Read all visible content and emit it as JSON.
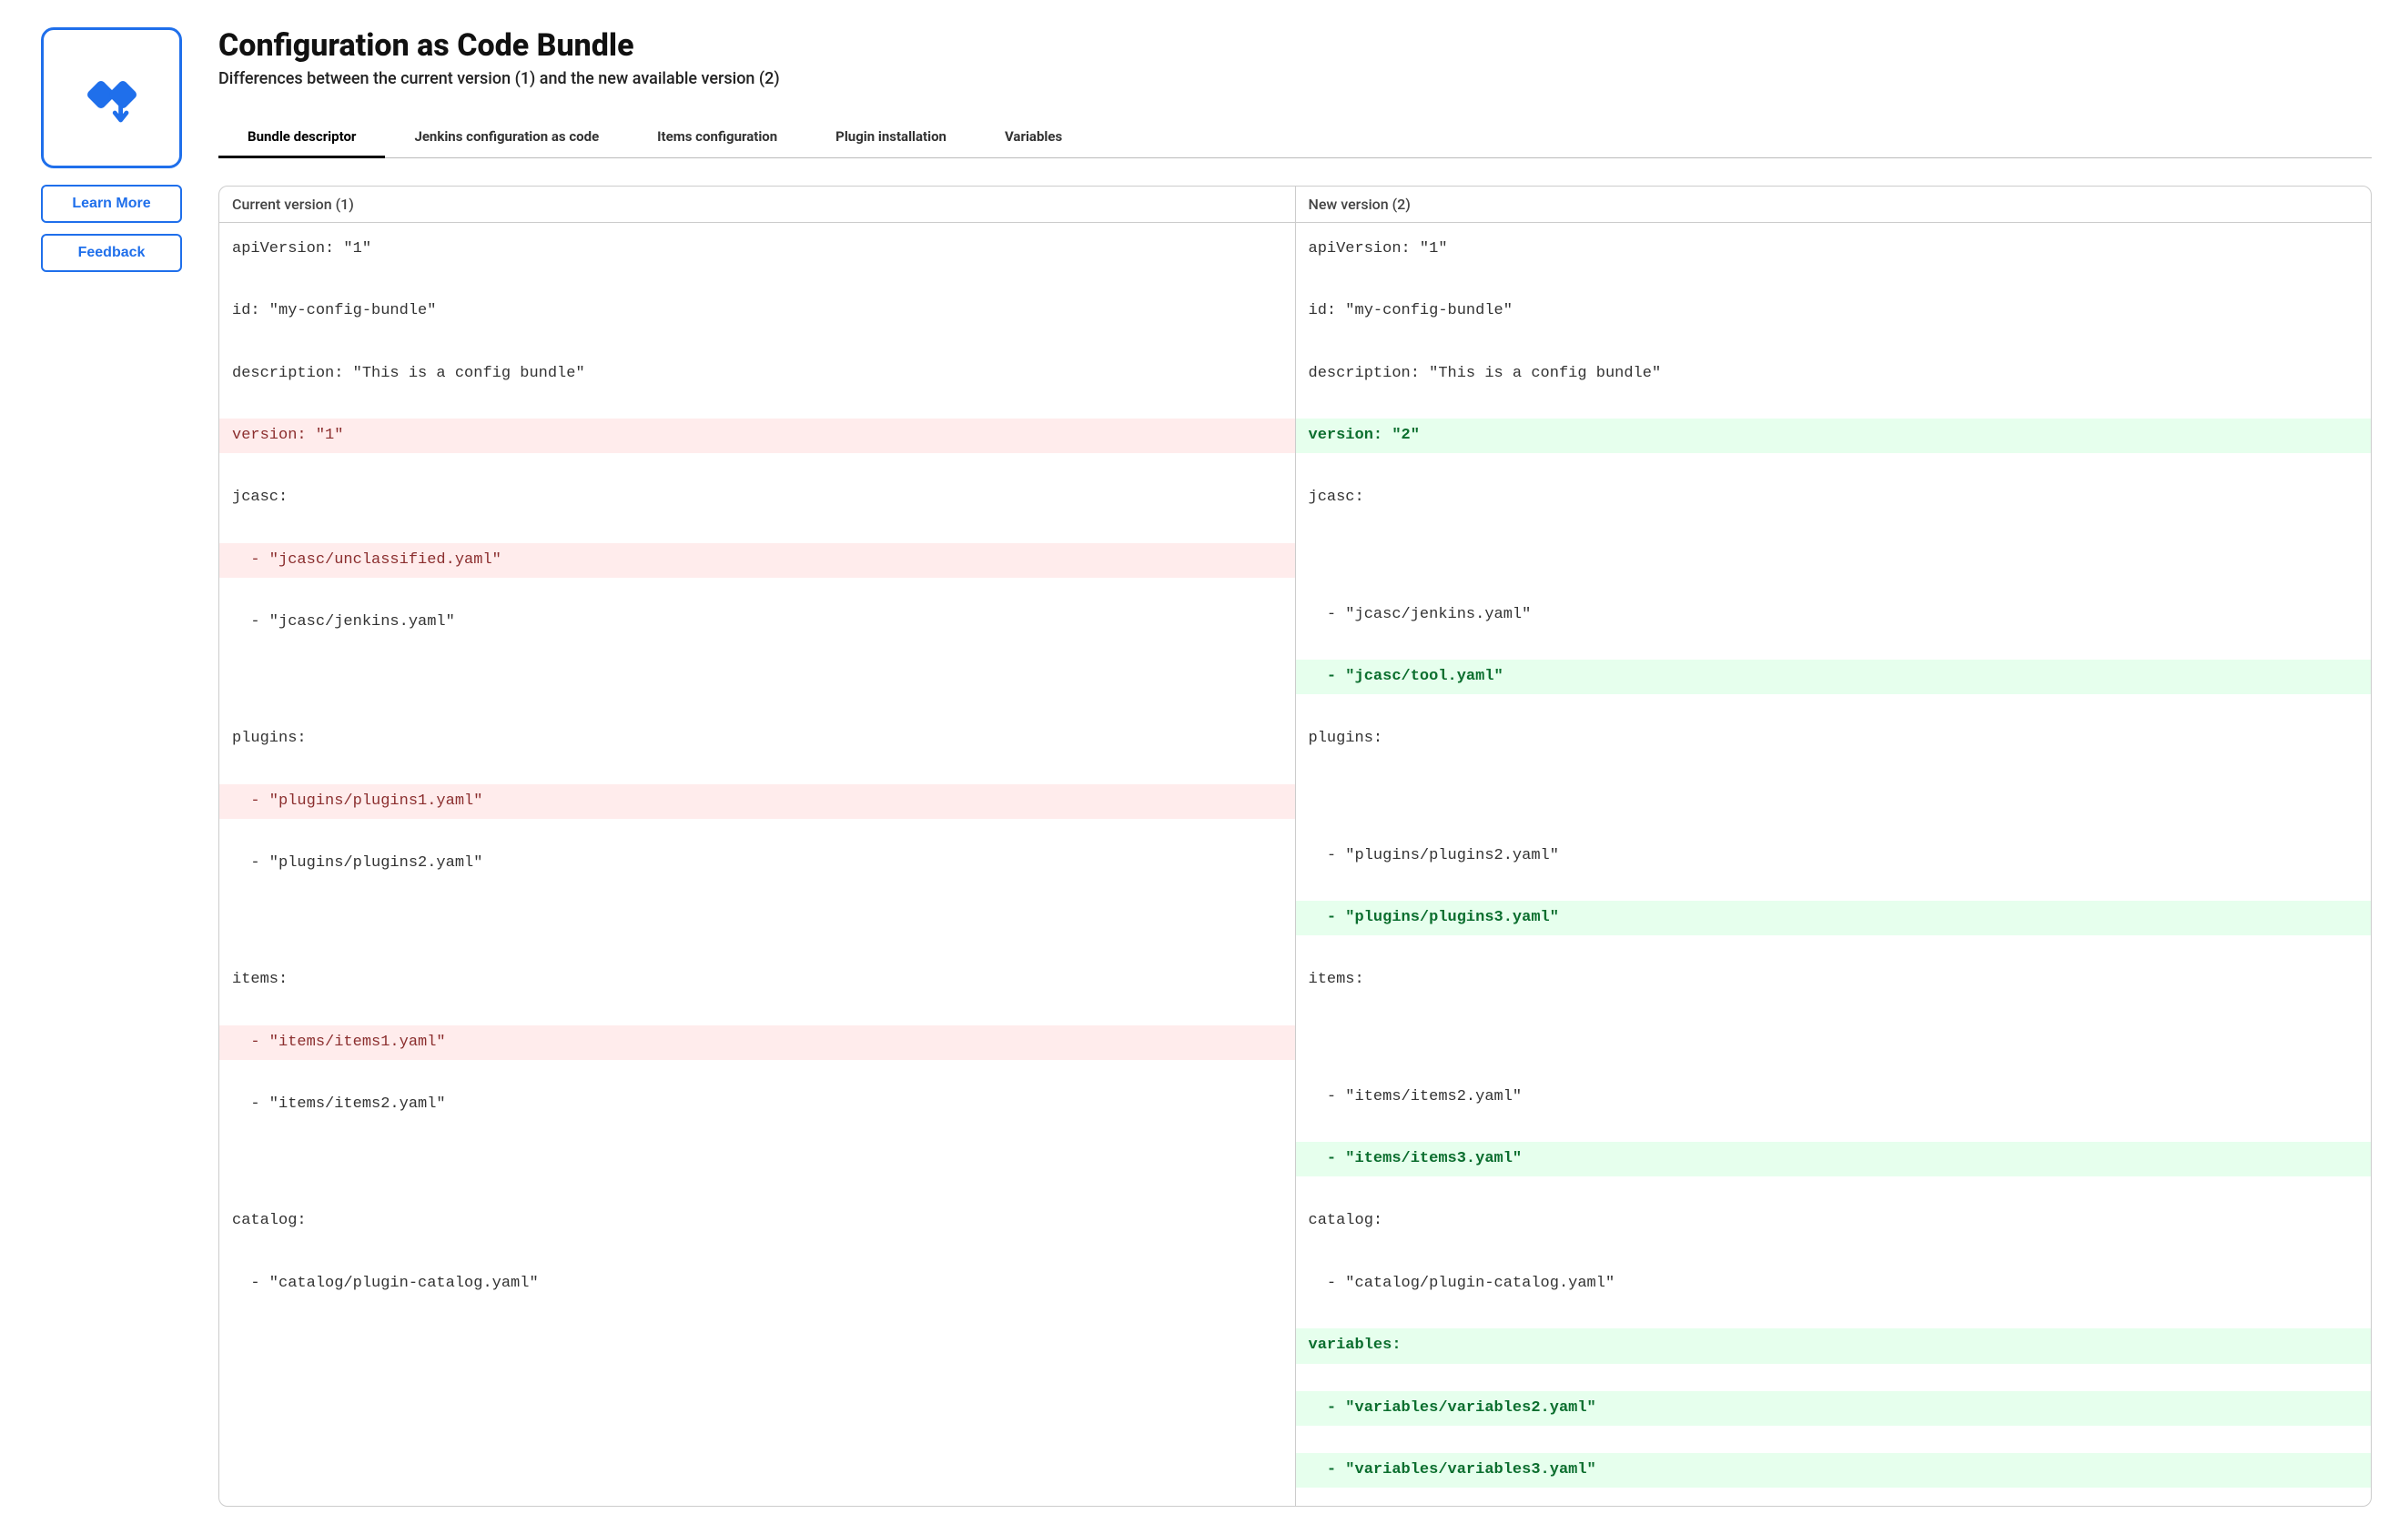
{
  "header": {
    "title": "Configuration as Code Bundle",
    "subtitle": "Differences between the current version (1) and the new available version (2)"
  },
  "sidebar": {
    "learn_more": "Learn More",
    "feedback": "Feedback"
  },
  "tabs": [
    {
      "label": "Bundle descriptor",
      "active": true
    },
    {
      "label": "Jenkins configuration as code",
      "active": false
    },
    {
      "label": "Items configuration",
      "active": false
    },
    {
      "label": "Plugin installation",
      "active": false
    },
    {
      "label": "Variables",
      "active": false
    }
  ],
  "diff": {
    "left_header": "Current version (1)",
    "right_header": "New version (2)",
    "left_lines": [
      {
        "t": "apiVersion: \"1\"",
        "kind": "plain"
      },
      {
        "t": "",
        "kind": "blank"
      },
      {
        "t": "id: \"my-config-bundle\"",
        "kind": "plain"
      },
      {
        "t": "",
        "kind": "blank"
      },
      {
        "t": "description: \"This is a config bundle\"",
        "kind": "plain"
      },
      {
        "t": "",
        "kind": "blank"
      },
      {
        "t": "version: \"1\"",
        "kind": "changed-old"
      },
      {
        "t": "",
        "kind": "blank"
      },
      {
        "t": "jcasc:",
        "kind": "plain"
      },
      {
        "t": "",
        "kind": "blank"
      },
      {
        "t": "  - \"jcasc/unclassified.yaml\"",
        "kind": "removed"
      },
      {
        "t": "",
        "kind": "blank"
      },
      {
        "t": "  - \"jcasc/jenkins.yaml\"",
        "kind": "plain"
      },
      {
        "t": "",
        "kind": "blank"
      },
      {
        "t": "",
        "kind": "blank"
      },
      {
        "t": "",
        "kind": "blank"
      },
      {
        "t": "plugins:",
        "kind": "plain"
      },
      {
        "t": "",
        "kind": "blank"
      },
      {
        "t": "  - \"plugins/plugins1.yaml\"",
        "kind": "removed"
      },
      {
        "t": "",
        "kind": "blank"
      },
      {
        "t": "  - \"plugins/plugins2.yaml\"",
        "kind": "plain"
      },
      {
        "t": "",
        "kind": "blank"
      },
      {
        "t": "",
        "kind": "blank"
      },
      {
        "t": "",
        "kind": "blank"
      },
      {
        "t": "items:",
        "kind": "plain"
      },
      {
        "t": "",
        "kind": "blank"
      },
      {
        "t": "  - \"items/items1.yaml\"",
        "kind": "removed"
      },
      {
        "t": "",
        "kind": "blank"
      },
      {
        "t": "  - \"items/items2.yaml\"",
        "kind": "plain"
      },
      {
        "t": "",
        "kind": "blank"
      },
      {
        "t": "",
        "kind": "blank"
      },
      {
        "t": "",
        "kind": "blank"
      },
      {
        "t": "catalog:",
        "kind": "plain"
      },
      {
        "t": "",
        "kind": "blank"
      },
      {
        "t": "  - \"catalog/plugin-catalog.yaml\"",
        "kind": "plain"
      },
      {
        "t": "",
        "kind": "blank"
      },
      {
        "t": "",
        "kind": "blank"
      },
      {
        "t": "",
        "kind": "blank"
      },
      {
        "t": "",
        "kind": "blank"
      },
      {
        "t": "",
        "kind": "blank"
      },
      {
        "t": "",
        "kind": "blank"
      }
    ],
    "right_lines": [
      {
        "t": "apiVersion: \"1\"",
        "kind": "plain"
      },
      {
        "t": "",
        "kind": "blank"
      },
      {
        "t": "id: \"my-config-bundle\"",
        "kind": "plain"
      },
      {
        "t": "",
        "kind": "blank"
      },
      {
        "t": "description: \"This is a config bundle\"",
        "kind": "plain"
      },
      {
        "t": "",
        "kind": "blank"
      },
      {
        "t": "version: \"2\"",
        "kind": "changed-new"
      },
      {
        "t": "",
        "kind": "blank"
      },
      {
        "t": "jcasc:",
        "kind": "plain"
      },
      {
        "t": "",
        "kind": "blank"
      },
      {
        "t": "",
        "kind": "blank"
      },
      {
        "t": "",
        "kind": "blank"
      },
      {
        "t": "  - \"jcasc/jenkins.yaml\"",
        "kind": "plain"
      },
      {
        "t": "",
        "kind": "blank"
      },
      {
        "t": "  - \"jcasc/tool.yaml\"",
        "kind": "added"
      },
      {
        "t": "",
        "kind": "blank"
      },
      {
        "t": "plugins:",
        "kind": "plain"
      },
      {
        "t": "",
        "kind": "blank"
      },
      {
        "t": "",
        "kind": "blank"
      },
      {
        "t": "",
        "kind": "blank"
      },
      {
        "t": "  - \"plugins/plugins2.yaml\"",
        "kind": "plain"
      },
      {
        "t": "",
        "kind": "blank"
      },
      {
        "t": "  - \"plugins/plugins3.yaml\"",
        "kind": "added"
      },
      {
        "t": "",
        "kind": "blank"
      },
      {
        "t": "items:",
        "kind": "plain"
      },
      {
        "t": "",
        "kind": "blank"
      },
      {
        "t": "",
        "kind": "blank"
      },
      {
        "t": "",
        "kind": "blank"
      },
      {
        "t": "  - \"items/items2.yaml\"",
        "kind": "plain"
      },
      {
        "t": "",
        "kind": "blank"
      },
      {
        "t": "  - \"items/items3.yaml\"",
        "kind": "added"
      },
      {
        "t": "",
        "kind": "blank"
      },
      {
        "t": "catalog:",
        "kind": "plain"
      },
      {
        "t": "",
        "kind": "blank"
      },
      {
        "t": "  - \"catalog/plugin-catalog.yaml\"",
        "kind": "plain"
      },
      {
        "t": "",
        "kind": "blank"
      },
      {
        "t": "variables:",
        "kind": "added"
      },
      {
        "t": "",
        "kind": "blank"
      },
      {
        "t": "  - \"variables/variables2.yaml\"",
        "kind": "added"
      },
      {
        "t": "",
        "kind": "blank"
      },
      {
        "t": "  - \"variables/variables3.yaml\"",
        "kind": "added"
      }
    ]
  }
}
